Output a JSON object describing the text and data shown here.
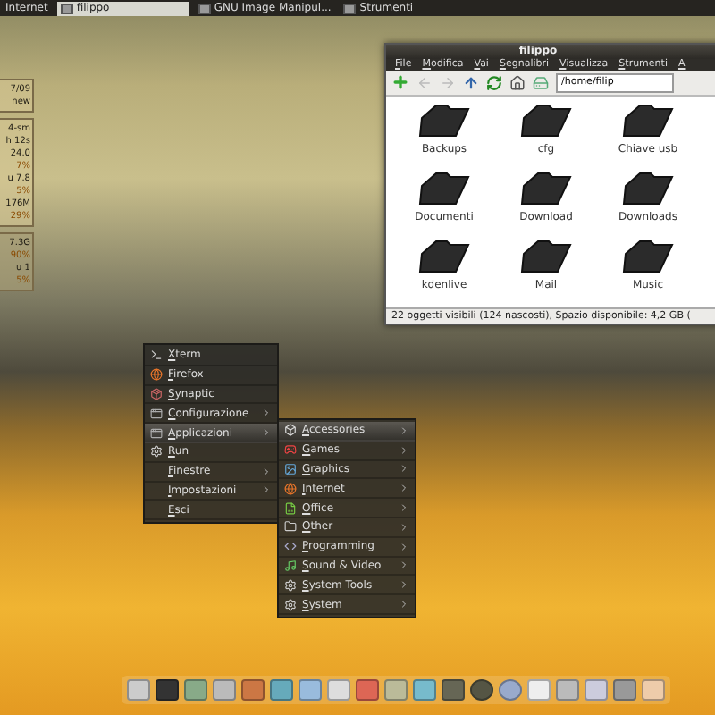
{
  "top_panel": {
    "items": [
      {
        "kind": "label",
        "label": "Internet",
        "selected": false
      },
      {
        "kind": "task",
        "label": "filippo",
        "selected": true
      },
      {
        "kind": "task",
        "label": "GNU Image Manipul...",
        "selected": false
      },
      {
        "kind": "task",
        "label": "Strumenti",
        "selected": false
      }
    ]
  },
  "system_monitor": {
    "panels": [
      {
        "lines": [
          {
            "text": "7/09",
            "kind": "value"
          },
          {
            "text": "new",
            "kind": "value"
          }
        ]
      },
      {
        "lines": [
          {
            "text": "4-sm",
            "kind": "value"
          },
          {
            "text": "h 12s",
            "kind": "value"
          },
          {
            "text": "24.0",
            "kind": "value"
          },
          {
            "text": "7%",
            "kind": "percent"
          },
          {
            "text": "u 7.8",
            "kind": "value"
          },
          {
            "text": "5%",
            "kind": "percent"
          },
          {
            "text": "176M",
            "kind": "value"
          },
          {
            "text": "29%",
            "kind": "percent"
          }
        ]
      },
      {
        "lines": [
          {
            "text": "7.3G",
            "kind": "value"
          },
          {
            "text": "90%",
            "kind": "percent"
          },
          {
            "text": "u 1",
            "kind": "value"
          },
          {
            "text": "5%",
            "kind": "percent"
          }
        ]
      }
    ]
  },
  "file_manager": {
    "title": "filippo",
    "menu": [
      "File",
      "Modifica",
      "Vai",
      "Segnalibri",
      "Visualizza",
      "Strumenti",
      "A"
    ],
    "path": "/home/filip",
    "items": [
      "Backups",
      "cfg",
      "Chiave usb",
      "Documenti",
      "Download",
      "Downloads",
      "kdenlive",
      "Mail",
      "Music"
    ],
    "status": "22 oggetti visibili (124 nascosti), Spazio disponibile: 4,2 GB ("
  },
  "menu": {
    "items": [
      {
        "label": "Xterm",
        "kind": "terminal",
        "submenu": false,
        "selected": false
      },
      {
        "label": "Firefox",
        "kind": "globe",
        "submenu": false,
        "selected": false
      },
      {
        "label": "Synaptic",
        "kind": "package",
        "submenu": false,
        "selected": false
      },
      {
        "label": "Configurazione",
        "kind": "window",
        "submenu": true,
        "selected": false
      },
      {
        "label": "Applicazioni",
        "kind": "window",
        "submenu": true,
        "selected": true
      },
      {
        "label": "Run",
        "kind": "gear",
        "submenu": false,
        "selected": false
      },
      {
        "label": "Finestre",
        "kind": "plain",
        "submenu": true,
        "selected": false
      },
      {
        "label": "Impostazioni",
        "kind": "plain",
        "submenu": true,
        "selected": false
      },
      {
        "label": "Esci",
        "kind": "plain",
        "submenu": false,
        "selected": false
      }
    ]
  },
  "submenu": {
    "items": [
      {
        "label": "Accessories",
        "kind": "box",
        "selected": true
      },
      {
        "label": "Games",
        "kind": "gamepad",
        "selected": false
      },
      {
        "label": "Graphics",
        "kind": "image",
        "selected": false
      },
      {
        "label": "Internet",
        "kind": "globe",
        "selected": false
      },
      {
        "label": "Office",
        "kind": "sheet",
        "selected": false
      },
      {
        "label": "Other",
        "kind": "folder",
        "selected": false
      },
      {
        "label": "Programming",
        "kind": "code",
        "selected": false
      },
      {
        "label": "Sound & Video",
        "kind": "music",
        "selected": false
      },
      {
        "label": "System Tools",
        "kind": "gear",
        "selected": false
      },
      {
        "label": "System",
        "kind": "gear",
        "selected": false
      }
    ]
  }
}
